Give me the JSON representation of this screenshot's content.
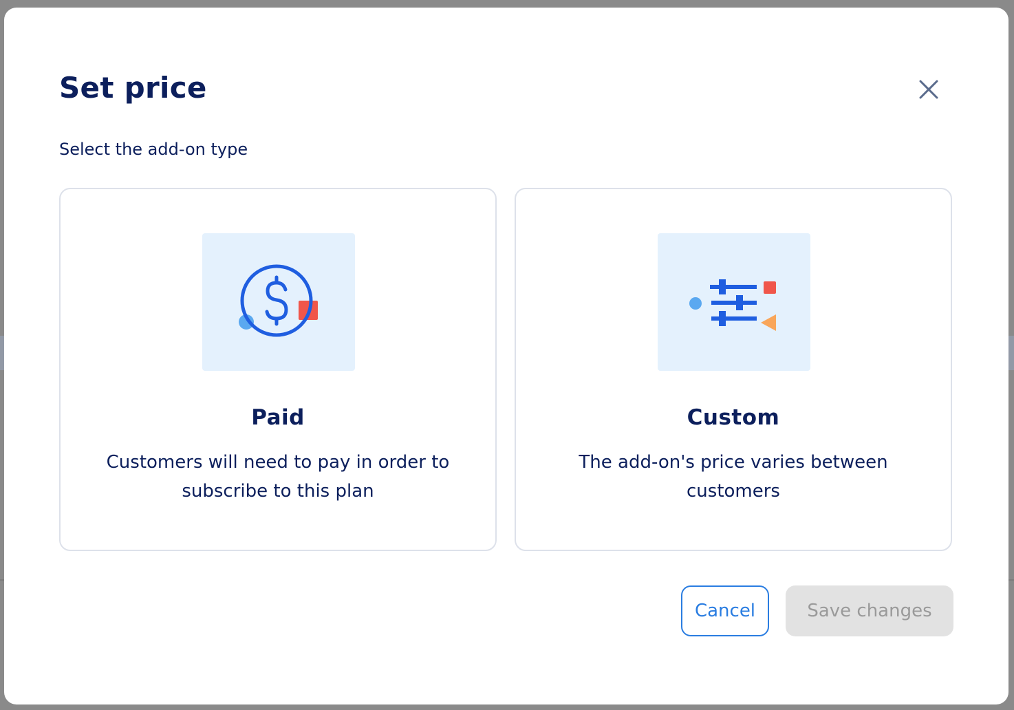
{
  "modal": {
    "title": "Set price",
    "subtitle": "Select the add-on type",
    "close_icon": "close-icon"
  },
  "options": [
    {
      "title": "Paid",
      "description": "Customers will need to pay in order to subscribe to this plan",
      "icon": "dollar-circle-icon"
    },
    {
      "title": "Custom",
      "description": "The add-on's price varies between customers",
      "icon": "sliders-icon"
    }
  ],
  "footer": {
    "cancel_label": "Cancel",
    "save_label": "Save changes",
    "save_disabled": true
  },
  "colors": {
    "primary_text": "#0c1f5c",
    "accent_blue": "#2a7de1",
    "icon_blue": "#1f5ee0",
    "illustration_bg": "#e4f1fd",
    "red_accent": "#f0564a",
    "orange_accent": "#f9a65a",
    "light_blue_accent": "#5aa8f0",
    "disabled_bg": "#e2e2e2",
    "disabled_text": "#9a9a9a"
  }
}
